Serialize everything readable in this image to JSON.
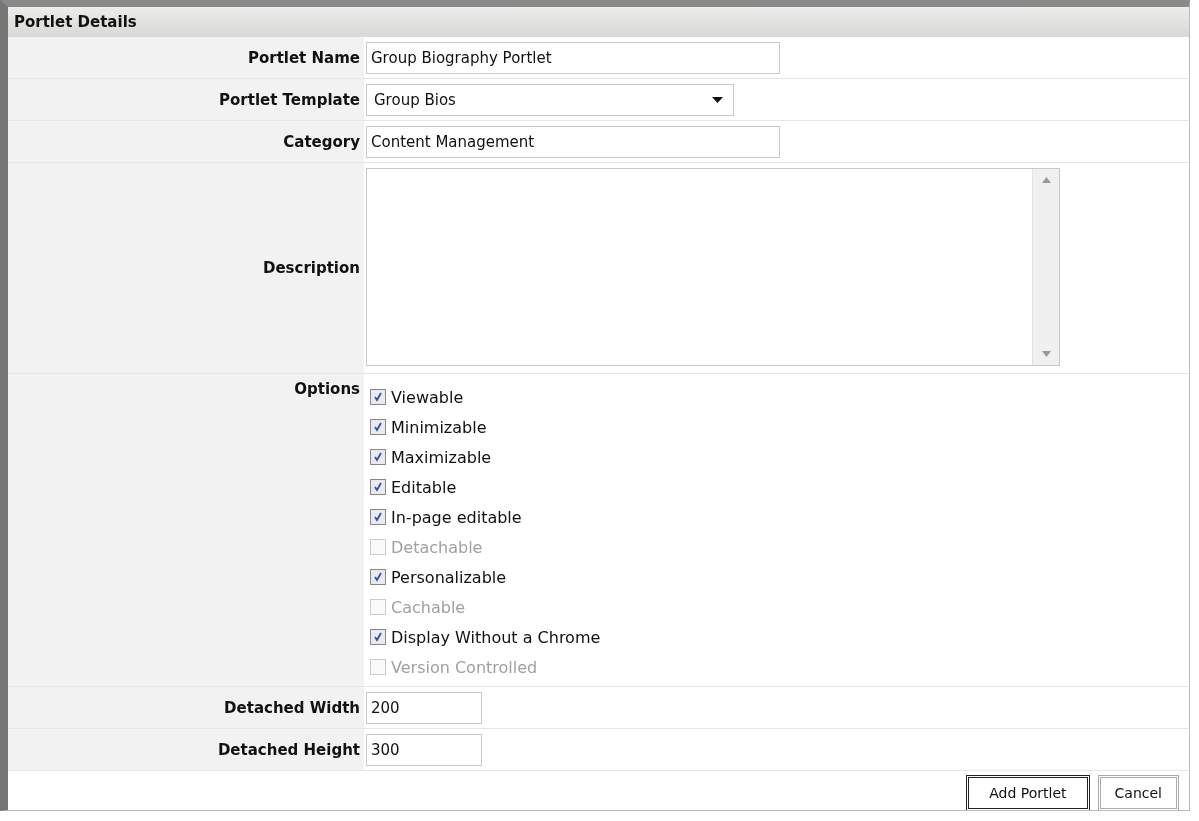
{
  "panel": {
    "title": "Portlet Details"
  },
  "fields": [
    {
      "kind": "text",
      "label": "Portlet Name",
      "value": "Group Biography Portlet"
    },
    {
      "kind": "select",
      "label": "Portlet Template",
      "value": "Group Bios"
    },
    {
      "kind": "text",
      "label": "Category",
      "value": "Content Management"
    },
    {
      "kind": "textarea",
      "label": "Description"
    }
  ],
  "options": {
    "label": "Options",
    "items": [
      {
        "label": "Viewable",
        "checked": true,
        "disabled": false
      },
      {
        "label": "Minimizable",
        "checked": true,
        "disabled": false
      },
      {
        "label": "Maximizable",
        "checked": true,
        "disabled": false
      },
      {
        "label": "Editable",
        "checked": true,
        "disabled": false
      },
      {
        "label": "In-page editable",
        "checked": true,
        "disabled": false
      },
      {
        "label": "Detachable",
        "checked": false,
        "disabled": true
      },
      {
        "label": "Personalizable",
        "checked": true,
        "disabled": false
      },
      {
        "label": "Cachable",
        "checked": false,
        "disabled": true
      },
      {
        "label": "Display Without a Chrome",
        "checked": true,
        "disabled": false
      },
      {
        "label": "Version Controlled",
        "checked": false,
        "disabled": true
      }
    ]
  },
  "size_fields": [
    {
      "label": "Detached Width",
      "value": "200"
    },
    {
      "label": "Detached Height",
      "value": "300"
    }
  ],
  "buttons": [
    {
      "label": "Add Portlet",
      "default": true
    },
    {
      "label": "Cancel",
      "default": false
    }
  ]
}
